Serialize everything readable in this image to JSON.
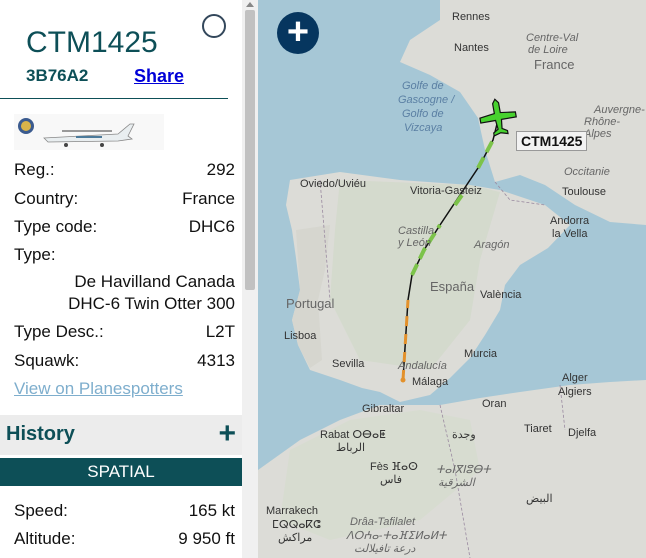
{
  "aircraft": {
    "callsign": "CTM1425",
    "hex": "3B76A2",
    "share_label": "Share",
    "close_icon": "⊗"
  },
  "details": {
    "reg_label": "Reg.:",
    "reg_value": "292",
    "country_label": "Country:",
    "country_value": "France",
    "typecode_label": "Type code:",
    "typecode_value": "DHC6",
    "type_label": "Type:",
    "type_value_1": "De Havilland Canada",
    "type_value_2": "DHC-6 Twin Otter 300",
    "typedesc_label": "Type Desc.:",
    "typedesc_value": "L2T",
    "squawk_label": "Squawk:",
    "squawk_value": "4313",
    "planespotters_link": "View on Planespotters"
  },
  "history": {
    "title": "History",
    "plus": "+"
  },
  "spatial": {
    "title": "SPATIAL"
  },
  "metrics": {
    "speed_label": "Speed:",
    "speed_value": "165 kt",
    "altitude_label": "Altitude:",
    "altitude_value": "9 950 ft"
  },
  "map": {
    "zoom_in": "+",
    "aircraft_label": "CTM1425",
    "labels": {
      "rennes": "Rennes",
      "nantes": "Nantes",
      "centre": "Centre-Val",
      "loire": "de Loire",
      "france": "France",
      "golfe1": "Golfe de",
      "golfe2": "Gascogne /",
      "golfe3": "Golfo de",
      "golfe4": "Vizcaya",
      "auvergne1": "Auvergne-",
      "auvergne2": "Rhône-Alpes",
      "occitanie": "Occitanie",
      "oviedo": "Oviedo/Uviéu",
      "vitoria": "Vitoria-Gasteiz",
      "toulouse": "Toulouse",
      "andorra1": "Andorra",
      "andorra2": "la Vella",
      "castilla1": "Castilla",
      "castilla2": "y León",
      "aragon": "Aragón",
      "portugal": "Portugal",
      "espana": "España",
      "valencia": "València",
      "lisboa": "Lisboa",
      "sevilla": "Sevilla",
      "andalucia": "Andalucía",
      "murcia": "Murcia",
      "malaga": "Málaga",
      "gibraltar": "Gibraltar",
      "oran": "Oran",
      "alger": "Alger",
      "algiers": "Algiers",
      "rabat1": "Rabat ⵔⴱⴰⵟ",
      "rabat2": "الرباط",
      "wajda": "وجدة",
      "tiaret": "Tiaret",
      "djelfa": "Djelfa",
      "fes1": "Fès ⴼⴰⵙ",
      "fes2": "فاس",
      "oriental1": "ⵜⴰⵏⴳⵏⵓⴱⵜ",
      "oriental2": "الشرقية",
      "baida": "البيض",
      "marrakech1": "Marrakech",
      "marrakech2": "ⵎⵕⵕⴰⴽⵛ",
      "marrakech3": "مراكش",
      "draa1": "Drâa-Tafilalet",
      "draa2": "ⴷⵔⵄⴰ-ⵜⴰⴼⵉⵍⴰⵍⵜ",
      "draa3": "درعة تافيلالت"
    }
  }
}
